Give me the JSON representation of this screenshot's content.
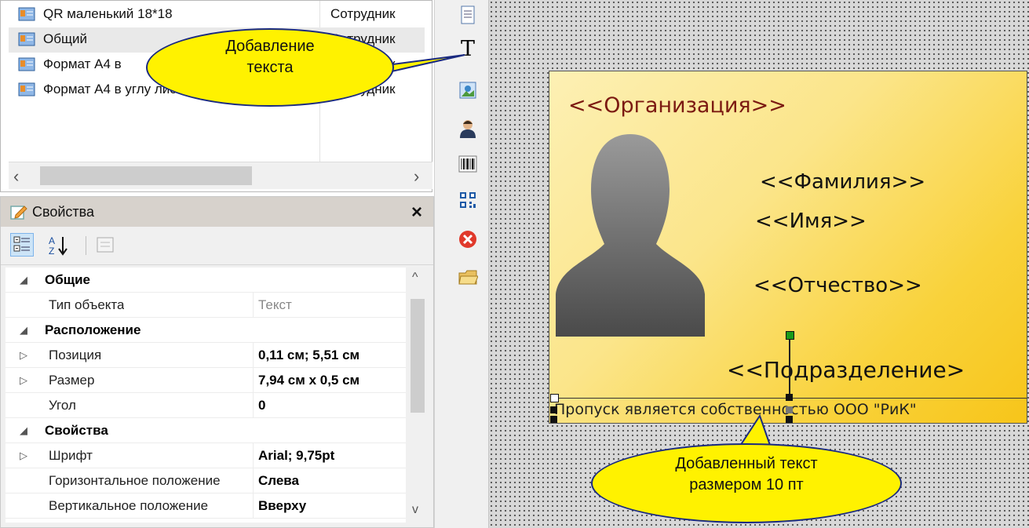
{
  "templates": [
    {
      "name": "QR маленький 18*18",
      "type": "Сотрудник"
    },
    {
      "name": "Общий",
      "type": "Сотрудник"
    },
    {
      "name": "Формат А4 в",
      "type": "Сотрудник"
    },
    {
      "name": "Формат А4 в углу листа",
      "type": "Сотрудник"
    }
  ],
  "properties_panel": {
    "title": "Свойства",
    "close_symbol": "×",
    "sort_symbol": "A Z ↓",
    "rows": [
      {
        "kind": "category",
        "label": "Общие"
      },
      {
        "kind": "prop",
        "label": "Тип объекта",
        "value": "Текст"
      },
      {
        "kind": "category",
        "label": "Расположение"
      },
      {
        "kind": "prop",
        "label": "Позиция",
        "value": "0,11 см; 5,51 см"
      },
      {
        "kind": "prop",
        "label": "Размер",
        "value": "7,94 см x 0,5 см"
      },
      {
        "kind": "prop",
        "label": "Угол",
        "value": "0"
      },
      {
        "kind": "category",
        "label": "Свойства"
      },
      {
        "kind": "prop",
        "label": "Шрифт",
        "value": "Arial; 9,75pt"
      },
      {
        "kind": "prop",
        "label": "Горизонтальное положение",
        "value": "Слева"
      },
      {
        "kind": "prop",
        "label": "Вертикальное положение",
        "value": "Вверху"
      }
    ]
  },
  "toolbox": {
    "text_tool_glyph": "T",
    "tools": [
      "document-icon",
      "text-icon",
      "image-icon",
      "photo-icon",
      "barcode-icon",
      "qr-code-icon",
      "delete-icon",
      "open-folder-icon"
    ]
  },
  "card": {
    "organization": "<<Организация>>",
    "surname": "<<Фамилия>>",
    "name": "<<Имя>>",
    "patronymic": "<<Отчество>>",
    "department": "<<Подразделение>",
    "footer_text": "Пропуск является собственностью ООО \"РиК\""
  },
  "callouts": {
    "add_text": [
      "Добавление",
      "текста"
    ],
    "added_text": [
      "Добавленный текст",
      "размером 10 пт"
    ]
  },
  "colors": {
    "callout_fill": "#fff200",
    "organization_text": "#7b1a12",
    "card_gradient_end": "#f7c51a",
    "selection_handle_top": "#1a9a1a"
  }
}
